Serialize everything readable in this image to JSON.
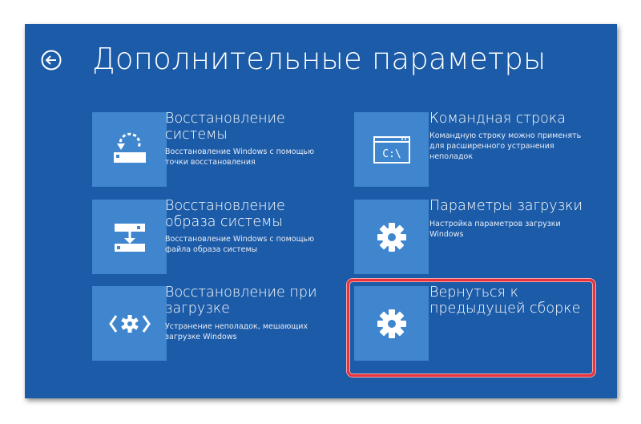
{
  "header": {
    "title": "Дополнительные параметры",
    "back_icon": "back-arrow-icon"
  },
  "options": [
    {
      "title_line1": "Восстановление",
      "title_line2": "системы",
      "description_line1": "Восстановление Windows с помощью",
      "description_line2": "точки восстановления",
      "icon": "system-restore-icon"
    },
    {
      "title_line1": "Командная строка",
      "title_line2": "",
      "description_line1": "Командную строку можно применять",
      "description_line2": "для расширенного устранения",
      "description_line3": "неполадок",
      "icon": "command-prompt-icon",
      "icon_text": "C:\\"
    },
    {
      "title_line1": "Восстановление",
      "title_line2": "образа системы",
      "description_line1": "Восстановление Windows с помощью",
      "description_line2": "файла образа системы",
      "icon": "system-image-recovery-icon"
    },
    {
      "title_line1": "Параметры загрузки",
      "title_line2": "",
      "description_line1": "Настройка параметров загрузки",
      "description_line2": "Windows",
      "icon": "gear-icon"
    },
    {
      "title_line1": "Восстановление при",
      "title_line2": "загрузке",
      "description_line1": "Устранение неполадок, мешающих",
      "description_line2": "загрузке Windows",
      "icon": "startup-repair-icon"
    },
    {
      "title_line1": "Вернуться к",
      "title_line2": "предыдущей сборке",
      "icon": "gear-icon"
    }
  ],
  "colors": {
    "background": "#1c5ba7",
    "tile": "#3f86cf",
    "text": "#ffffff",
    "highlight": "#e9323a"
  }
}
